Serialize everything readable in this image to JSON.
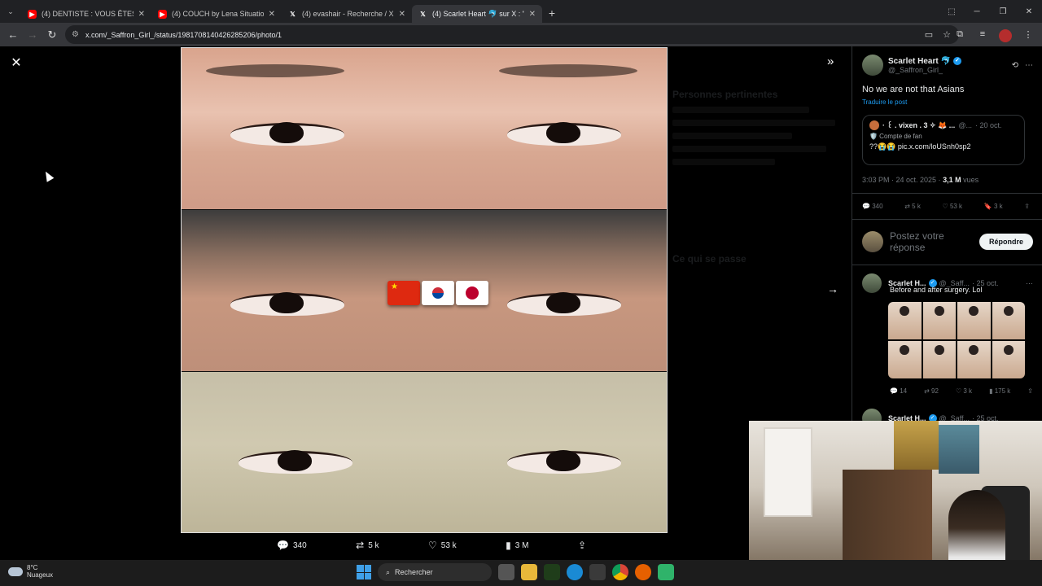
{
  "browser": {
    "tabs": [
      {
        "title": "(4) DENTISTE : VOUS ÊTES SALE",
        "favicon": "youtube-icon",
        "color": "#ff0000"
      },
      {
        "title": "(4) COUCH by Lena Situations",
        "favicon": "youtube-icon",
        "color": "#ff0000"
      },
      {
        "title": "(4) evashair - Recherche / X",
        "favicon": "x-icon",
        "color": "#000000"
      },
      {
        "title": "(4) Scarlet Heart 🐬 sur X : \"No",
        "favicon": "x-icon",
        "color": "#000000",
        "active": true
      }
    ],
    "url": "x.com/_Saffron_Girl_/status/1981708140426285206/photo/1"
  },
  "viewer": {
    "flags": [
      "cn",
      "kr",
      "jp"
    ],
    "actions": {
      "replies": "340",
      "reposts": "5 k",
      "likes": "53 k",
      "views": "3 M"
    },
    "ghost": {
      "relevant": "Personnes pertinentes",
      "happening": "Ce qui se passe"
    }
  },
  "post": {
    "author": "Scarlet Heart 🐬",
    "handle": "@_Saffron_Girl_",
    "text": "No we are not    that Asians",
    "translate": "Traduire le post",
    "quote": {
      "name": "· ꒰ . vixen . 3 ✧ 🦊 ...",
      "handle": "@...",
      "date": "· 20 oct.",
      "badge": "🛡️ Compte de fan",
      "text": "??😭😭 pic.x.com/loUSnh0sp2"
    },
    "time": "3:03 PM · 24 oct. 2025 · ",
    "views_count": "3,1 M",
    "views_label": " vues",
    "stats": {
      "replies": "340",
      "reposts": "5 k",
      "likes": "53 k",
      "bookmarks": "3 k"
    },
    "reply_placeholder": "Postez votre réponse",
    "reply_button": "Répondre"
  },
  "thread": [
    {
      "name": "Scarlet H...",
      "handle": "@_Saff...",
      "date": "· 25 oct.",
      "text": "Before and after surgery. Lol",
      "stats": {
        "replies": "14",
        "reposts": "92",
        "likes": "3 k",
        "views": "175 k"
      }
    },
    {
      "name": "Scarlet H...",
      "handle": "@_Saff...",
      "date": "· 25 oct."
    }
  ],
  "taskbar": {
    "temp": "8°C",
    "weather": "Nuageux",
    "search": "Rechercher"
  },
  "colors": {
    "accent": "#1d9bf0",
    "background": "#000000"
  }
}
